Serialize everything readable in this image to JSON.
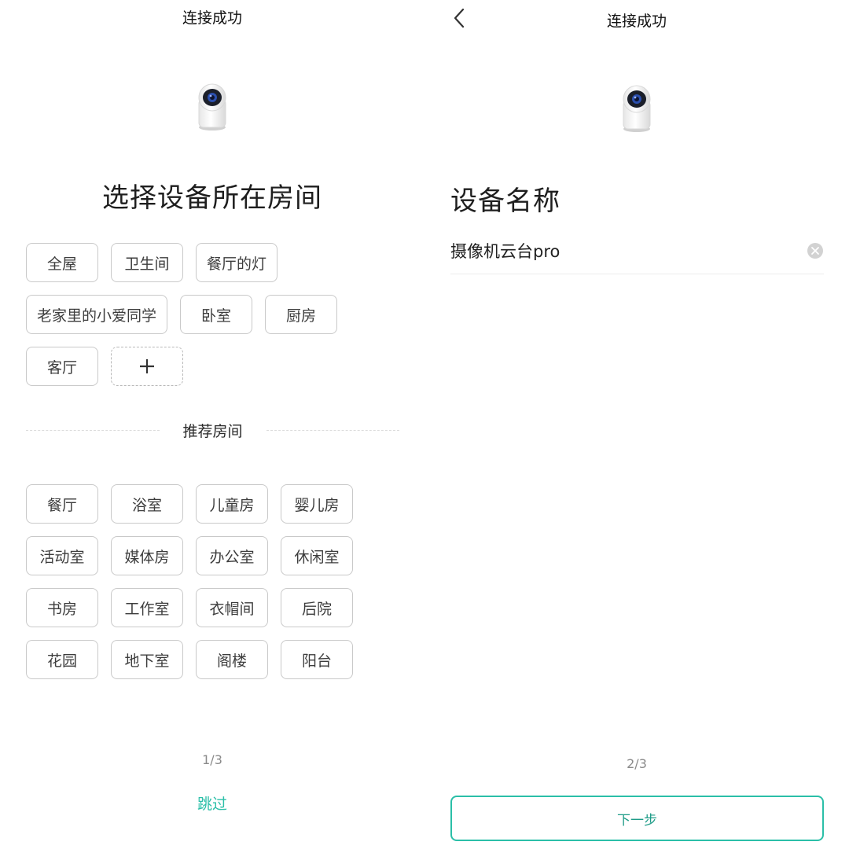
{
  "left": {
    "title": "连接成功",
    "heading": "选择设备所在房间",
    "rooms": [
      "全屋",
      "卫生间",
      "餐厅的灯",
      "老家里的小爱同学",
      "卧室",
      "厨房",
      "客厅"
    ],
    "add_icon": "plus-icon",
    "recommended_label": "推荐房间",
    "recommended_rooms": [
      "餐厅",
      "浴室",
      "儿童房",
      "婴儿房",
      "活动室",
      "媒体房",
      "办公室",
      "休闲室",
      "书房",
      "工作室",
      "衣帽间",
      "后院",
      "花园",
      "地下室",
      "阁楼",
      "阳台"
    ],
    "pager": "1/3",
    "skip_label": "跳过"
  },
  "right": {
    "title": "连接成功",
    "back_icon": "chevron-left-icon",
    "heading": "设备名称",
    "device_name_value": "摄像机云台pro",
    "clear_icon": "clear-icon",
    "pager": "2/3",
    "next_label": "下一步"
  },
  "colors": {
    "accent": "#2bbfa8",
    "chip_border": "#c9c9c9",
    "text_primary": "#1e1e1e",
    "text_secondary": "#8a8a8a"
  }
}
